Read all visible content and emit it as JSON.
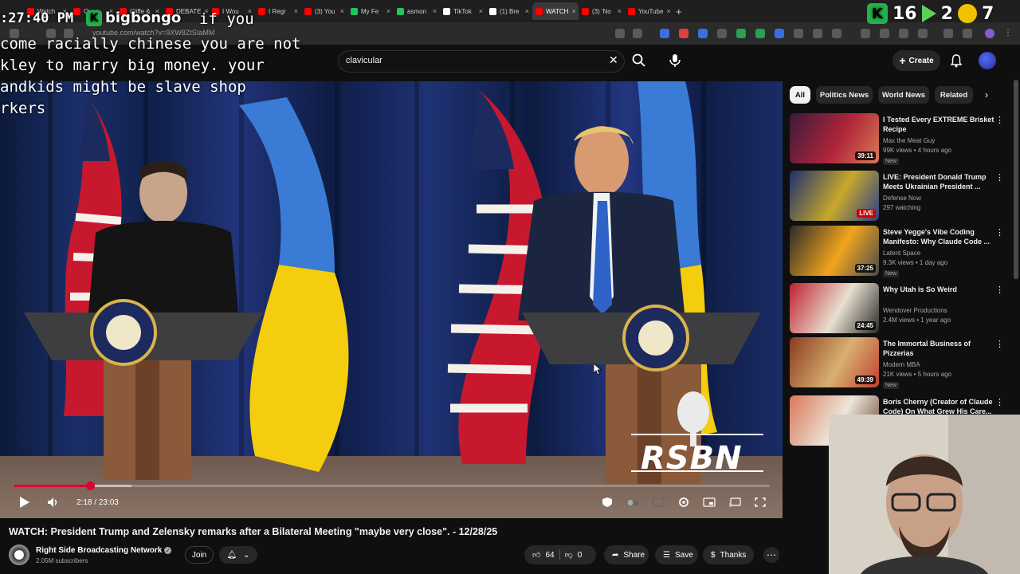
{
  "browser": {
    "tabs": [
      {
        "label": "Watch",
        "color": "#ff0000"
      },
      {
        "label": "Oven",
        "color": "#ff0000"
      },
      {
        "label": "Cliffe &",
        "color": "#ff0000"
      },
      {
        "label": "DEBATE",
        "color": "#ff0000"
      },
      {
        "label": "I Wou",
        "color": "#ff0000"
      },
      {
        "label": "I Regr",
        "color": "#ff0000"
      },
      {
        "label": "(3) You",
        "color": "#ff0000"
      },
      {
        "label": "My Fe",
        "color": "#22c55e"
      },
      {
        "label": "asmon",
        "color": "#22c55e"
      },
      {
        "label": "TikTok",
        "color": "#ffffff"
      },
      {
        "label": "(1) Bre",
        "color": "#ffffff"
      },
      {
        "label": "WATCH",
        "color": "#ff0000",
        "active": true
      },
      {
        "label": "(3) 'No",
        "color": "#ff0000"
      },
      {
        "label": "YouTube",
        "color": "#ff0000"
      }
    ],
    "url": "youtube.com/watch?v=9XW8ZtSIaMM"
  },
  "stream_overlay": {
    "clock": ":27:40 PM",
    "chat_username": "bigbongo",
    "chat_message_first": "if you",
    "chat_message_lines": [
      "come racially chinese you are not",
      "kley to marry big money. your",
      "andkids might be slave shop",
      "rkers"
    ],
    "right_numbers": [
      "16",
      "2",
      "7"
    ]
  },
  "header": {
    "search_value": "clavicular",
    "create_label": "Create"
  },
  "video": {
    "current_time": "2:18",
    "duration": "23:03",
    "progress": 0.1,
    "buffered": 0.155,
    "watermark": "RSBN"
  },
  "title": "WATCH: President Trump and Zelensky remarks after a Bilateral Meeting \"maybe very close\". - 12/28/25",
  "channel": {
    "name": "Right Side Broadcasting Network",
    "subscribers": "2.05M subscribers",
    "join_label": "Join"
  },
  "actions": {
    "likes": "64",
    "dislikes": "0",
    "share": "Share",
    "save": "Save",
    "thanks": "Thanks"
  },
  "chips": [
    {
      "label": "All",
      "active": true
    },
    {
      "label": "Politics News"
    },
    {
      "label": "World News"
    },
    {
      "label": "Related"
    }
  ],
  "recommendations": [
    {
      "title": "I Tested Every EXTREME Brisket Recipe",
      "channel": "Max the Meat Guy",
      "meta": "99K views • 4 hours ago",
      "duration": "39:11",
      "new": "New",
      "colors": [
        "#3b1a3a",
        "#b0253a",
        "#d87a55"
      ]
    },
    {
      "title": "LIVE: President Donald Trump Meets Ukrainian President ...",
      "channel": "Defense Now",
      "meta": "297 watching",
      "duration": "LIVE",
      "live": true,
      "colors": [
        "#1d2f6e",
        "#c8a82a",
        "#2a3f8a"
      ]
    },
    {
      "title": "Steve Yegge's Vibe Coding Manifesto: Why Claude Code ...",
      "channel": "Latent Space",
      "meta": "9.3K views • 1 day ago",
      "duration": "37:25",
      "new": "New",
      "colors": [
        "#2a2a2a",
        "#f2a51d",
        "#4a4a4a"
      ]
    },
    {
      "title": "Why Utah is So Weird",
      "channel": "Wendover Productions",
      "meta": "2.4M views • 1 year ago",
      "duration": "24:45",
      "colors": [
        "#c02030",
        "#e8e0d0",
        "#2a2a2a"
      ]
    },
    {
      "title": "The Immortal Business of Pizzerias",
      "channel": "Modern MBA",
      "meta": "21K views • 5 hours ago",
      "duration": "49:39",
      "new": "New",
      "colors": [
        "#8a3a20",
        "#d8b070",
        "#c04030"
      ]
    },
    {
      "title": "Boris Cherny (Creator of Claude Code) On What Grew His Care...",
      "channel": "",
      "meta": "",
      "duration": "",
      "colors": [
        "#d97757",
        "#ece6dc",
        "#6a4030"
      ]
    }
  ]
}
